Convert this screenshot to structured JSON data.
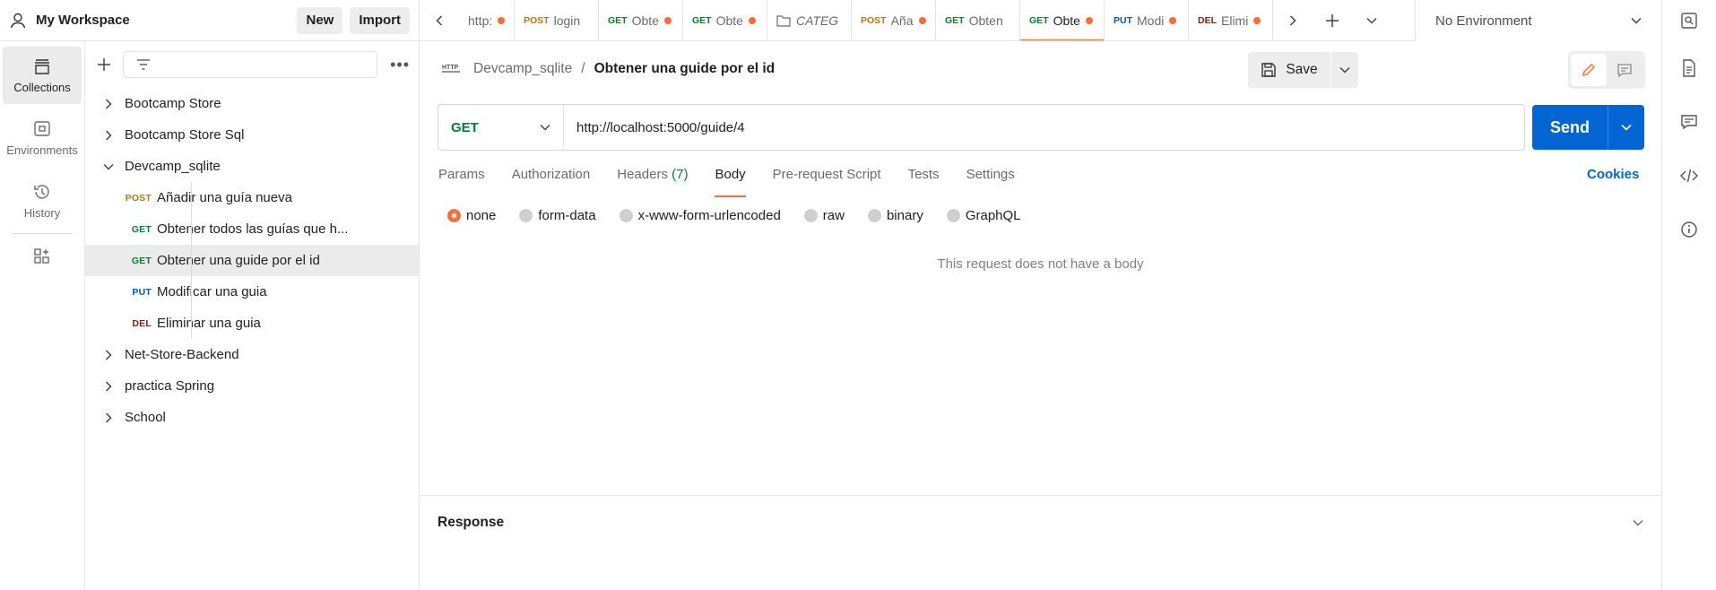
{
  "workspace": {
    "title": "My Workspace",
    "new_label": "New",
    "import_label": "Import"
  },
  "rail": {
    "items": [
      {
        "label": "Collections",
        "icon": "collections-icon",
        "active": true
      },
      {
        "label": "Environments",
        "icon": "environments-icon",
        "active": false
      },
      {
        "label": "History",
        "icon": "history-icon",
        "active": false
      }
    ]
  },
  "sidebar": {
    "filter_placeholder": "",
    "collections": [
      {
        "name": "Bootcamp Store",
        "expanded": false
      },
      {
        "name": "Bootcamp Store Sql",
        "expanded": false
      },
      {
        "name": "Devcamp_sqlite",
        "expanded": true
      },
      {
        "name": "Net-Store-Backend",
        "expanded": false
      },
      {
        "name": "practica Spring",
        "expanded": false
      },
      {
        "name": "School",
        "expanded": false
      }
    ],
    "requests": [
      {
        "method": "POST",
        "name": "Añadir una guía nueva"
      },
      {
        "method": "GET",
        "name": "Obtener todos las guías que h..."
      },
      {
        "method": "GET",
        "name": "Obtener una guide por el id",
        "selected": true
      },
      {
        "method": "PUT",
        "name": "Modificar una guia"
      },
      {
        "method": "DEL",
        "name": "Eliminar una guia"
      }
    ]
  },
  "tabs": [
    {
      "method": "",
      "name": "http:",
      "dot": true
    },
    {
      "method": "POST",
      "name": "login",
      "dot": false
    },
    {
      "method": "GET",
      "name": "Obte",
      "dot": true
    },
    {
      "method": "GET",
      "name": "Obte",
      "dot": true
    },
    {
      "method": "",
      "name": "CATEG",
      "dot": false,
      "folder": true
    },
    {
      "method": "POST",
      "name": "Aña",
      "dot": true
    },
    {
      "method": "GET",
      "name": "Obten",
      "dot": false
    },
    {
      "method": "GET",
      "name": "Obte",
      "dot": true,
      "active": true
    },
    {
      "method": "PUT",
      "name": "Modi",
      "dot": true
    },
    {
      "method": "DEL",
      "name": "Elimi",
      "dot": true
    }
  ],
  "environment": {
    "selected": "No Environment"
  },
  "request": {
    "breadcrumb_parent": "Devcamp_sqlite",
    "breadcrumb_sep": "/",
    "title": "Obtener una guide por el id",
    "save_label": "Save",
    "method": "GET",
    "url": "http://localhost:5000/guide/4",
    "send_label": "Send",
    "tabs": [
      "Params",
      "Authorization",
      "Headers",
      "Body",
      "Pre-request Script",
      "Tests",
      "Settings"
    ],
    "headers_count": "(7)",
    "cookies_label": "Cookies",
    "body_types": [
      "none",
      "form-data",
      "x-www-form-urlencoded",
      "raw",
      "binary",
      "GraphQL"
    ],
    "body_selected": "none",
    "empty_message": "This request does not have a body"
  },
  "response": {
    "title": "Response"
  },
  "colors": {
    "accent": "#ff6c37",
    "send": "#0265d2",
    "get": "#007f31",
    "post": "#ad7a03",
    "put": "#0053b8",
    "del": "#8e1a10"
  }
}
